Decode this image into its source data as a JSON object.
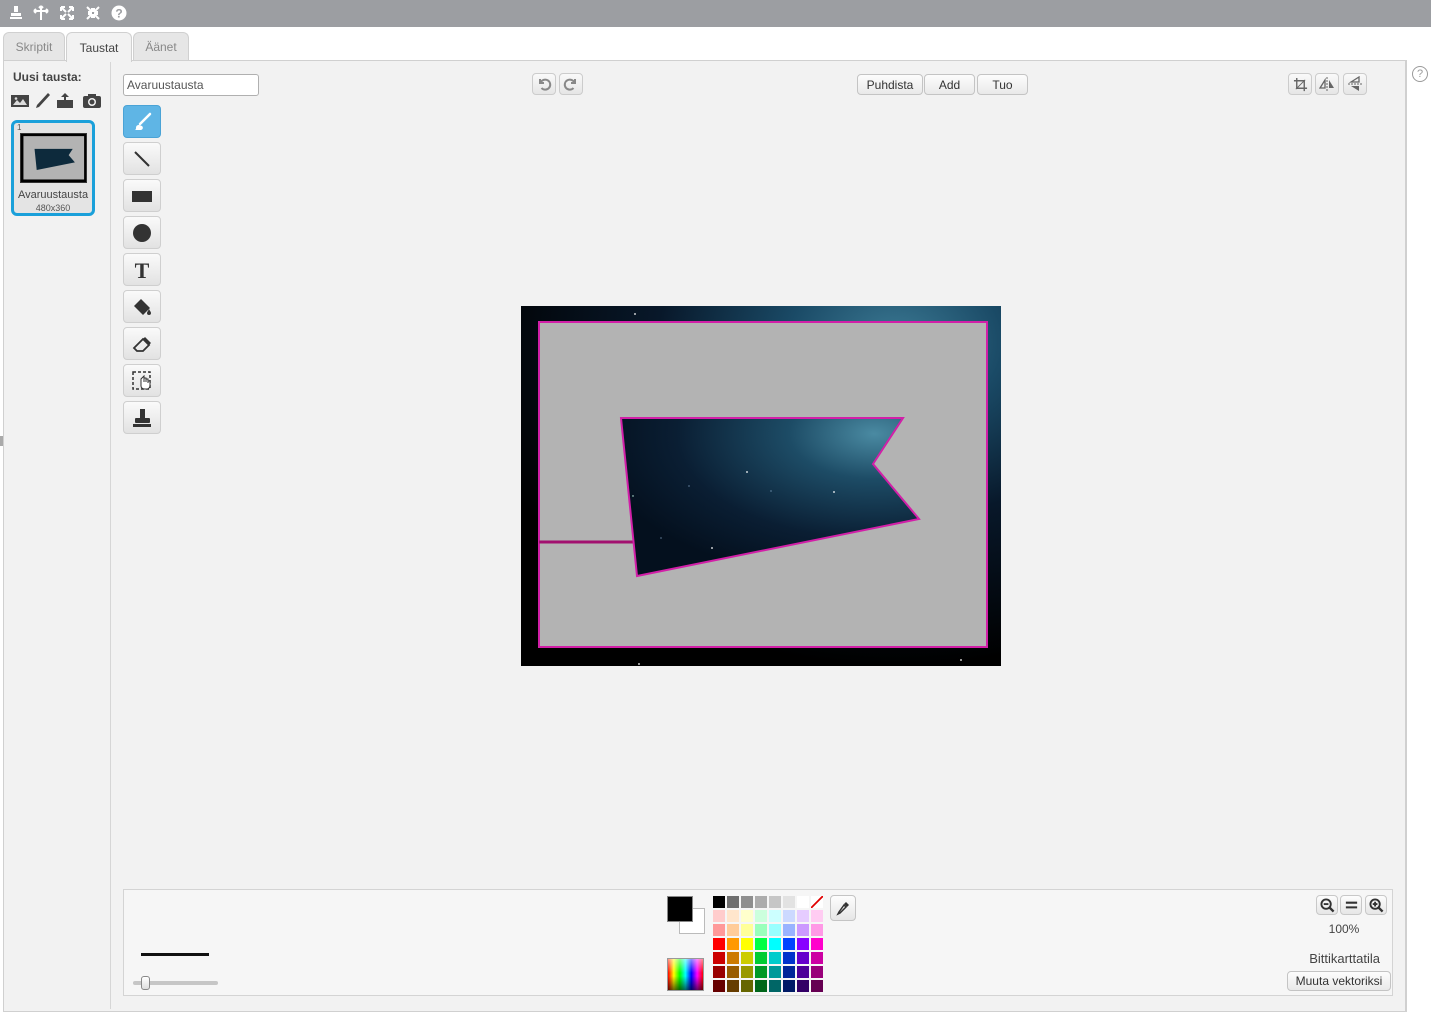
{
  "tabs": [
    {
      "label": "Skriptit"
    },
    {
      "label": "Taustat"
    },
    {
      "label": "Äänet"
    }
  ],
  "top_toolbar": {
    "icons": [
      "stamp-icon",
      "cut-icon",
      "grow-icon",
      "shrink-icon",
      "help-icon"
    ]
  },
  "backdrops": {
    "new_label": "Uusi tausta:",
    "new_icons": [
      "paint-from-library-icon",
      "paint-new-icon",
      "upload-icon",
      "camera-icon"
    ],
    "items": [
      {
        "index": "1",
        "name": "Avaruustausta",
        "size": "480x360"
      }
    ]
  },
  "editor": {
    "name_value": "Avaruustausta",
    "buttons": {
      "clear": "Puhdista",
      "add": "Add",
      "import": "Tuo"
    },
    "tools": [
      "brush-icon",
      "line-icon",
      "rectangle-icon",
      "ellipse-icon",
      "text-icon",
      "fill-icon",
      "eraser-icon",
      "select-icon",
      "stamp-icon"
    ],
    "active_tool": "brush-icon",
    "zoom": "100%",
    "mode": "Bittikarttatila",
    "convert_button": "Muuta vektoriksi"
  },
  "colors": {
    "primary": "#000000",
    "secondary": "#ffffff",
    "accent": "#1aa0da",
    "selection": "#d21fa8",
    "palette": [
      [
        "#000000",
        "#6e6e6e",
        "#8e8e8e",
        "#acacac",
        "#c6c6c6",
        "#e2e2e2",
        "#ffffff",
        "none"
      ],
      [
        "#ffcccc",
        "#ffe6cc",
        "#ffffcc",
        "#ccffdd",
        "#ccffff",
        "#ccd9ff",
        "#e6ccff",
        "#ffccf2"
      ],
      [
        "#ff9999",
        "#ffcc99",
        "#ffff99",
        "#99ffbb",
        "#99ffff",
        "#99b3ff",
        "#cc99ff",
        "#ff99e6"
      ],
      [
        "#ff0000",
        "#ff9900",
        "#ffff00",
        "#00ff44",
        "#00ffff",
        "#0044ff",
        "#8800ff",
        "#ff00cc"
      ],
      [
        "#cc0000",
        "#cc7a00",
        "#cccc00",
        "#00cc33",
        "#00cccc",
        "#0033cc",
        "#6600cc",
        "#cc00a3"
      ],
      [
        "#990000",
        "#995c00",
        "#999900",
        "#009926",
        "#009999",
        "#002699",
        "#4d0099",
        "#99007a"
      ],
      [
        "#660000",
        "#663d00",
        "#666600",
        "#00661a",
        "#006666",
        "#001a66",
        "#330066",
        "#660052"
      ]
    ]
  }
}
